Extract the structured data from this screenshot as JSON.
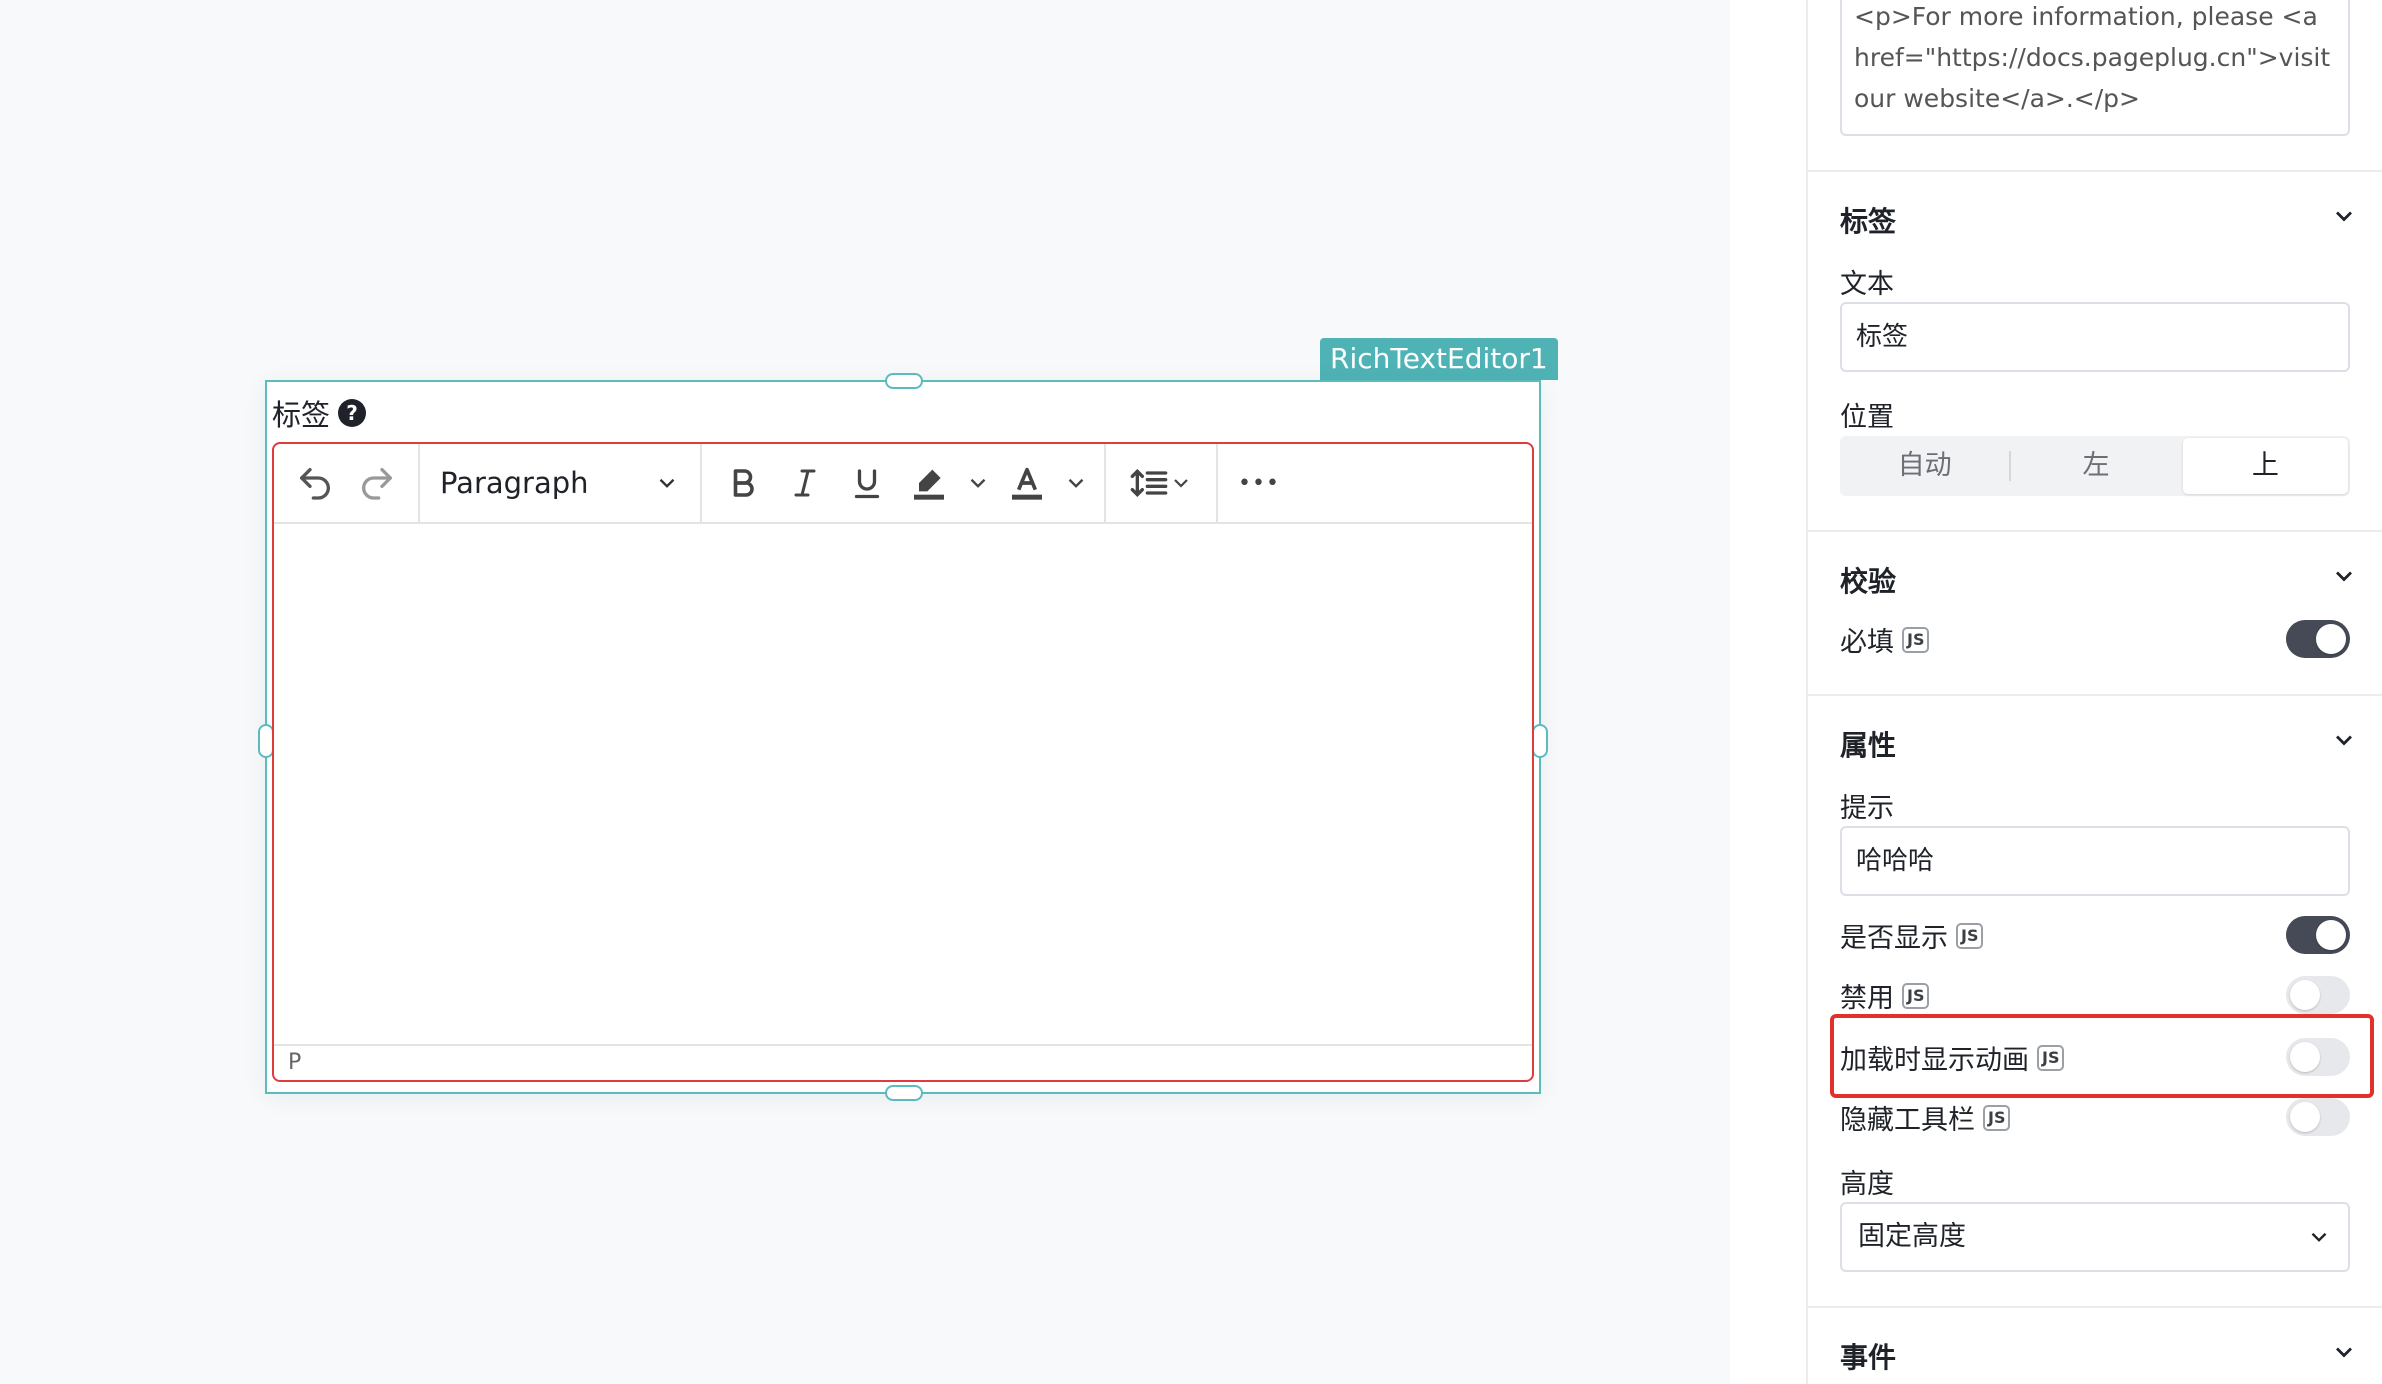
{
  "canvas": {
    "widget_name": "RichTextEditor1",
    "label": "标签",
    "help_icon": "?",
    "toolbar": {
      "undo_icon": "undo-icon",
      "redo_icon": "redo-icon",
      "format_value": "Paragraph",
      "more_icon": "•••"
    },
    "status_path": "P"
  },
  "panel": {
    "html_content": "<p>For more information, please <a href=\"https://docs.pageplug.cn\">visit our website</a>.</p>",
    "label_section": {
      "title": "标签",
      "text_label": "文本",
      "text_value": "标签",
      "position_label": "位置",
      "position_options": [
        "自动",
        "左",
        "上"
      ],
      "position_selected": "上"
    },
    "validation_section": {
      "title": "校验",
      "required_label": "必填",
      "required_on": true
    },
    "properties_section": {
      "title": "属性",
      "tooltip_label": "提示",
      "tooltip_value": "哈哈哈",
      "visible_label": "是否显示",
      "visible_on": true,
      "disabled_label": "禁用",
      "disabled_on": false,
      "animate_loading_label": "加载时显示动画",
      "animate_loading_on": false,
      "hide_toolbar_label": "隐藏工具栏",
      "hide_toolbar_on": false,
      "height_label": "高度",
      "height_value": "固定高度"
    },
    "events_section": {
      "title": "事件"
    },
    "js_badge": "JS"
  },
  "colors": {
    "widget_accent": "#4fb3b5",
    "editor_border": "#e03c3c",
    "toggle_on": "#454a56",
    "highlight": "#e0312a"
  }
}
